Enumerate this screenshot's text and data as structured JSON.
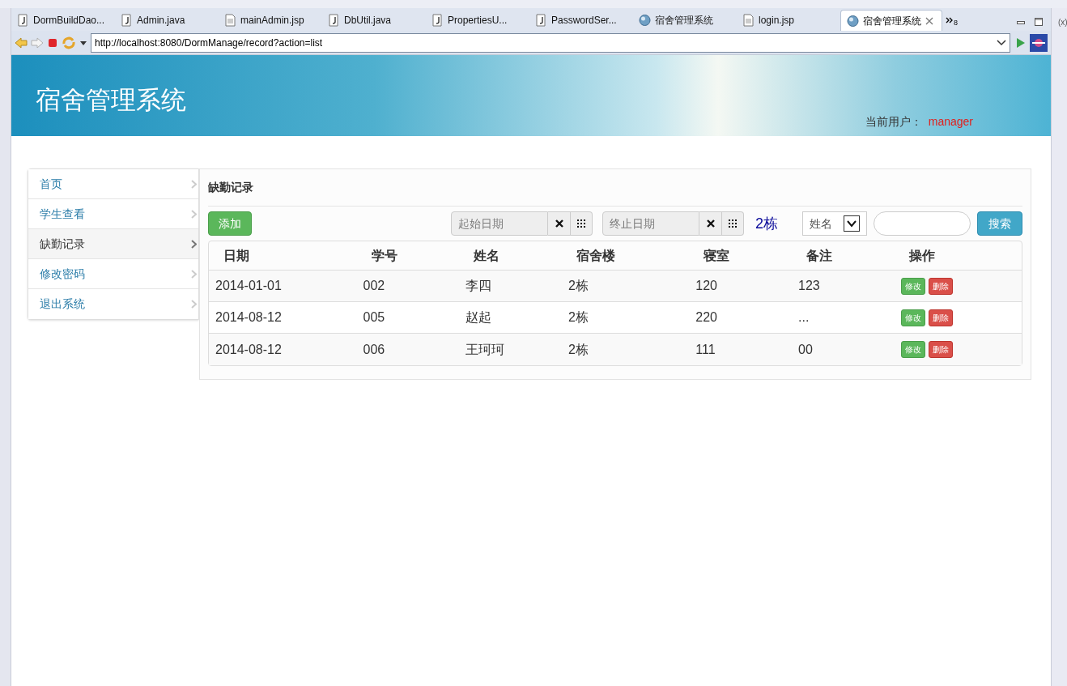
{
  "editor_tabs": [
    {
      "label": "DormBuildDao...",
      "kind": "java",
      "selected": false
    },
    {
      "label": "Admin.java",
      "kind": "java",
      "selected": false
    },
    {
      "label": "mainAdmin.jsp",
      "kind": "jsp",
      "selected": false
    },
    {
      "label": "DbUtil.java",
      "kind": "java",
      "selected": false
    },
    {
      "label": "PropertiesU...",
      "kind": "java",
      "selected": false
    },
    {
      "label": "PasswordSer...",
      "kind": "java",
      "selected": false
    },
    {
      "label": "宿舍管理系统",
      "kind": "web",
      "selected": false
    },
    {
      "label": "login.jsp",
      "kind": "jsp",
      "selected": false
    },
    {
      "label": "宿舍管理系统",
      "kind": "web",
      "selected": true
    }
  ],
  "hidden_tabs_count": "8",
  "side_panel_label": "(x)",
  "address_bar": {
    "url": "http://localhost:8080/DormManage/record?action=list"
  },
  "header": {
    "title": "宿舍管理系统",
    "user_label": "当前用户：",
    "user_name": "manager"
  },
  "sidebar": {
    "items": [
      {
        "label": "首页",
        "selected": false
      },
      {
        "label": "学生查看",
        "selected": false
      },
      {
        "label": "缺勤记录",
        "selected": true
      },
      {
        "label": "修改密码",
        "selected": false
      },
      {
        "label": "退出系统",
        "selected": false
      }
    ]
  },
  "panel": {
    "title": "缺勤记录",
    "add_button": "添加",
    "start_date": {
      "placeholder": "起始日期"
    },
    "end_date": {
      "placeholder": "终止日期"
    },
    "building": "2栋",
    "search_type": "姓名",
    "search_button": "搜索"
  },
  "table": {
    "columns": [
      "日期",
      "学号",
      "姓名",
      "宿舍楼",
      "寝室",
      "备注",
      "操作"
    ],
    "rows": [
      {
        "cells": [
          "2014-01-01",
          "002",
          "李四",
          "2栋",
          "120",
          "123"
        ],
        "actions": [
          "修改",
          "删除"
        ]
      },
      {
        "cells": [
          "2014-08-12",
          "005",
          "赵起",
          "2栋",
          "220",
          "..."
        ],
        "actions": [
          "修改",
          "删除"
        ]
      },
      {
        "cells": [
          "2014-08-12",
          "006",
          "王珂珂",
          "2栋",
          "111",
          "00"
        ],
        "actions": [
          "修改",
          "删除"
        ]
      }
    ]
  }
}
